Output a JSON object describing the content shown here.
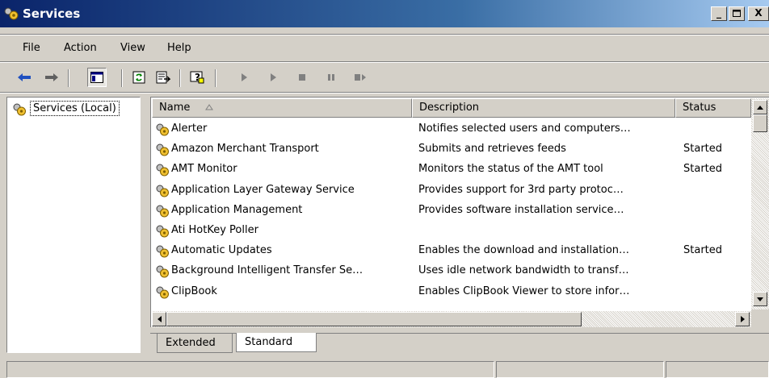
{
  "window": {
    "title": "Services"
  },
  "menu": {
    "items": [
      "File",
      "Action",
      "View",
      "Help"
    ]
  },
  "toolbar": {
    "buttons": [
      "back-arrow-icon",
      "forward-arrow-icon",
      "show-hide-console-tree-icon",
      "refresh-icon",
      "export-list-icon",
      "help-icon",
      "start-service-icon",
      "start-service-alt-icon",
      "stop-service-icon",
      "pause-service-icon",
      "restart-service-icon"
    ]
  },
  "tree": {
    "root_label": "Services (Local)"
  },
  "list": {
    "columns": [
      "Name",
      "Description",
      "Status"
    ],
    "sort_indicator": "ascending",
    "rows": [
      {
        "name": "Alerter",
        "description": "Notifies selected users and computers…",
        "status": ""
      },
      {
        "name": "Amazon Merchant Transport",
        "description": "Submits and retrieves feeds",
        "status": "Started"
      },
      {
        "name": "AMT Monitor",
        "description": "Monitors the status of the AMT tool",
        "status": "Started"
      },
      {
        "name": "Application Layer Gateway Service",
        "description": "Provides support for 3rd party protoc…",
        "status": ""
      },
      {
        "name": "Application Management",
        "description": "Provides software installation service…",
        "status": ""
      },
      {
        "name": "Ati HotKey Poller",
        "description": "",
        "status": ""
      },
      {
        "name": "Automatic Updates",
        "description": "Enables the download and installation…",
        "status": "Started"
      },
      {
        "name": "Background Intelligent Transfer Se…",
        "description": "Uses idle network bandwidth to transf…",
        "status": ""
      },
      {
        "name": "ClipBook",
        "description": "Enables ClipBook Viewer to store infor…",
        "status": ""
      }
    ]
  },
  "tabs": [
    {
      "label": "Extended",
      "active": false
    },
    {
      "label": "Standard",
      "active": true
    }
  ],
  "colors": {
    "title_bar": "#0a246a",
    "face": "#d4d0c8"
  }
}
